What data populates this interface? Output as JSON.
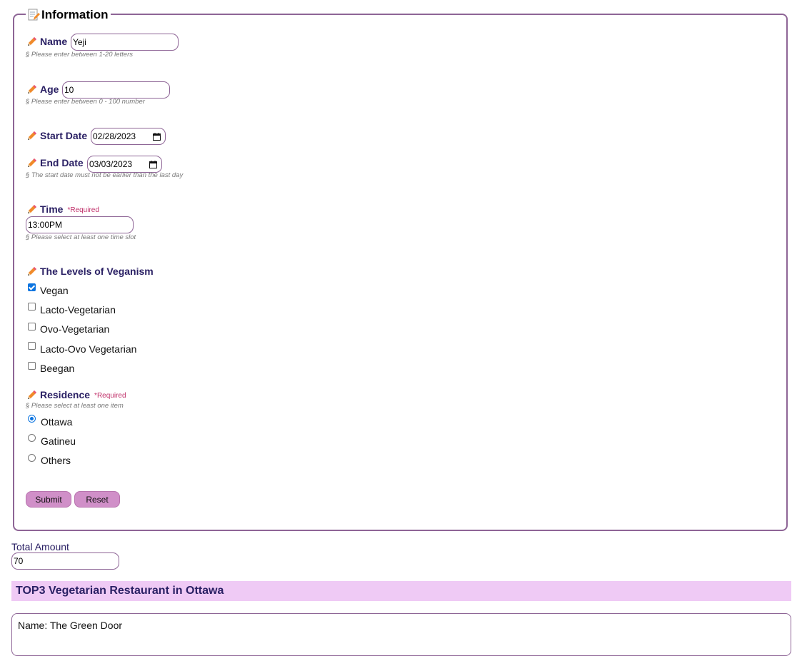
{
  "form": {
    "legend": "Information",
    "name": {
      "label": "Name",
      "value": "Yeji",
      "hint": "§ Please enter between 1-20 letters"
    },
    "age": {
      "label": "Age",
      "value": "10",
      "hint": "§ Please enter between 0 - 100 number"
    },
    "start_date": {
      "label": "Start Date",
      "value": "02/28/2023"
    },
    "end_date": {
      "label": "End Date",
      "value": "03/03/2023",
      "hint": "§ The start date must not be earlier than the last day"
    },
    "time": {
      "label": "Time",
      "required": "*Required",
      "value": "13:00PM",
      "hint": "§ Please select at least one time slot"
    },
    "veganism": {
      "label": "The Levels of Veganism",
      "options": [
        {
          "label": "Vegan",
          "checked": true
        },
        {
          "label": "Lacto-Vegetarian",
          "checked": false
        },
        {
          "label": "Ovo-Vegetarian",
          "checked": false
        },
        {
          "label": "Lacto-Ovo Vegetarian",
          "checked": false
        },
        {
          "label": "Beegan",
          "checked": false
        }
      ]
    },
    "residence": {
      "label": "Residence",
      "required": "*Required",
      "hint": "§ Please select at least one item",
      "options": [
        {
          "label": "Ottawa",
          "checked": true
        },
        {
          "label": "Gatineu",
          "checked": false
        },
        {
          "label": "Others",
          "checked": false
        }
      ]
    },
    "submit_label": "Submit",
    "reset_label": "Reset"
  },
  "total_amount": {
    "label": "Total Amount",
    "value": "70"
  },
  "restaurants": {
    "heading": "TOP3 Vegetarian Restaurant in Ottawa",
    "items": [
      {
        "name": "Name: The Green Door"
      }
    ]
  },
  "colors": {
    "accent": "#8e6596",
    "button": "#d08fc8",
    "banner": "#efcaf5",
    "label": "#2a2064",
    "required": "#c0306a",
    "check": "#0b74e0"
  },
  "icons": {
    "legend": "document-edit-icon",
    "label": "pencil-icon",
    "date": "calendar-icon"
  }
}
